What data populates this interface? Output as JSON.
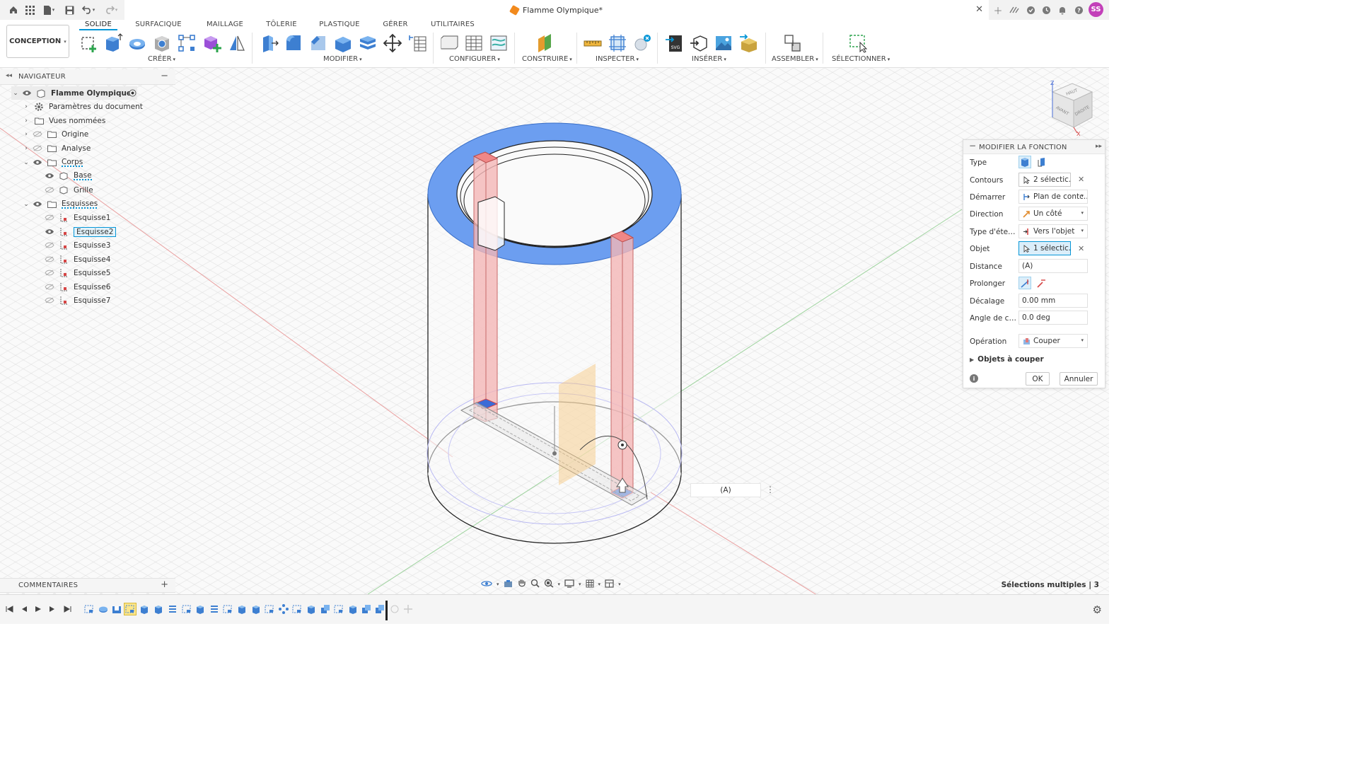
{
  "quick_access": {
    "home_icon": "home-icon",
    "apps_icon": "apps-grid-icon",
    "file_icon": "file-menu-icon",
    "save_icon": "save-icon",
    "undo_icon": "undo-icon",
    "redo_icon": "redo-icon"
  },
  "document_tab": {
    "title": "Flamme Olympique*",
    "icon": "design-cube-icon"
  },
  "user": {
    "initials": "SS",
    "color": "#c340b9"
  },
  "toolbar": {
    "workspace": "CONCEPTION",
    "tabs": [
      "SOLIDE",
      "SURFACIQUE",
      "MAILLAGE",
      "TÔLERIE",
      "PLASTIQUE",
      "GÉRER",
      "UTILITAIRES"
    ],
    "active_tab": "SOLIDE",
    "groups": [
      "CRÉER",
      "MODIFIER",
      "CONFIGURER",
      "CONSTRUIRE",
      "INSPECTER",
      "INSÉRER",
      "ASSEMBLER",
      "SÉLECTIONNER"
    ],
    "accent": "#0696d7"
  },
  "browser": {
    "title": "NAVIGATEUR",
    "root": "Flamme Olympique",
    "items": [
      {
        "label": "Paramètres du document"
      },
      {
        "label": "Vues nommées"
      },
      {
        "label": "Origine"
      },
      {
        "label": "Analyse"
      },
      {
        "label": "Corps"
      },
      {
        "label": "Base"
      },
      {
        "label": "Grille"
      },
      {
        "label": "Esquisses"
      },
      {
        "label": "Esquisse1"
      },
      {
        "label": "Esquisse2"
      },
      {
        "label": "Esquisse3"
      },
      {
        "label": "Esquisse4"
      },
      {
        "label": "Esquisse5"
      },
      {
        "label": "Esquisse6"
      },
      {
        "label": "Esquisse7"
      }
    ]
  },
  "comments": {
    "title": "COMMENTAIRES"
  },
  "viewcube": {
    "top": "HAUT",
    "front": "AVANT",
    "right": "DROITE"
  },
  "dimension_input": {
    "value": "(A)"
  },
  "dialog": {
    "title": "MODIFIER LA FONCTION",
    "rows": {
      "type": {
        "label": "Type"
      },
      "contours": {
        "label": "Contours",
        "value": "2 sélectic..."
      },
      "demarrer": {
        "label": "Démarrer",
        "value": "Plan de contc..."
      },
      "direction": {
        "label": "Direction",
        "value": "Un côté"
      },
      "type_etendue": {
        "label": "Type d'éten...",
        "value": "Vers l'objet"
      },
      "objet": {
        "label": "Objet",
        "value": "1 sélectic..."
      },
      "distance": {
        "label": "Distance",
        "value": "(A)"
      },
      "prolonger": {
        "label": "Prolonger"
      },
      "decalage": {
        "label": "Décalage",
        "value": "0.00 mm"
      },
      "angle": {
        "label": "Angle de co...",
        "value": "0.0 deg"
      },
      "operation": {
        "label": "Opération",
        "value": "Couper"
      }
    },
    "objets_a_couper": "Objets à couper",
    "ok": "OK",
    "cancel": "Annuler"
  },
  "status": {
    "text": "Sélections multiples | 3"
  }
}
